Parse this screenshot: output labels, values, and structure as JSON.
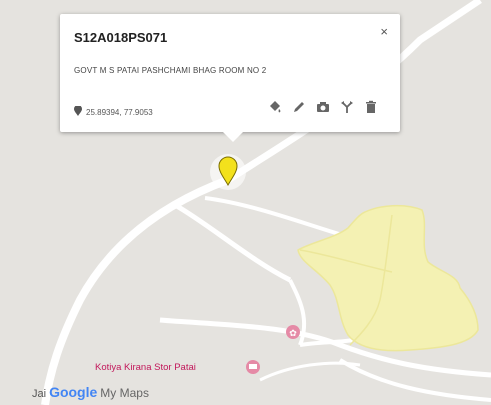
{
  "popup": {
    "title": "S12A018PS071",
    "description": "GOVT M S PATAI PASHCHAMI BHAG ROOM NO 2",
    "coordinates": "25.89394, 77.9053",
    "close_glyph": "×"
  },
  "tools": [
    "paint-bucket-icon",
    "pencil-icon",
    "camera-icon",
    "directions-icon",
    "trash-icon"
  ],
  "map": {
    "place_label": "Kotiya Kirana Stor Patai",
    "partial_label": "Jai",
    "brand": {
      "google": "Google",
      "product": "My Maps"
    }
  },
  "colors": {
    "map_background": "#e5e3df",
    "road": "#ffffff",
    "area_fill": "#f4f1b3",
    "area_stroke": "#ece79a",
    "marker": "#f3e11c",
    "poi_pink": "#e58aa6",
    "label_pink": "#c2185b"
  }
}
